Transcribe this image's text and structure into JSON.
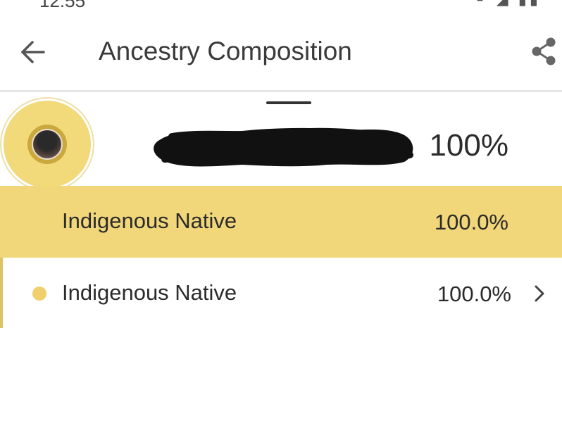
{
  "status_bar": {
    "time": "12:55",
    "icons": "⚭ ◢ ▮▮"
  },
  "header": {
    "title": "Ancestry Composition",
    "back_icon": "arrow-left-icon",
    "share_icon": "share-icon"
  },
  "profile": {
    "total_percent": "100%",
    "name_redacted": true
  },
  "colors": {
    "accent": "#f1d67a",
    "dot": "#efd06c"
  },
  "composition": {
    "group": {
      "label": "Indigenous Native",
      "percent": "100.0%"
    },
    "items": [
      {
        "label": "Indigenous Native",
        "percent": "100.0%"
      }
    ]
  }
}
